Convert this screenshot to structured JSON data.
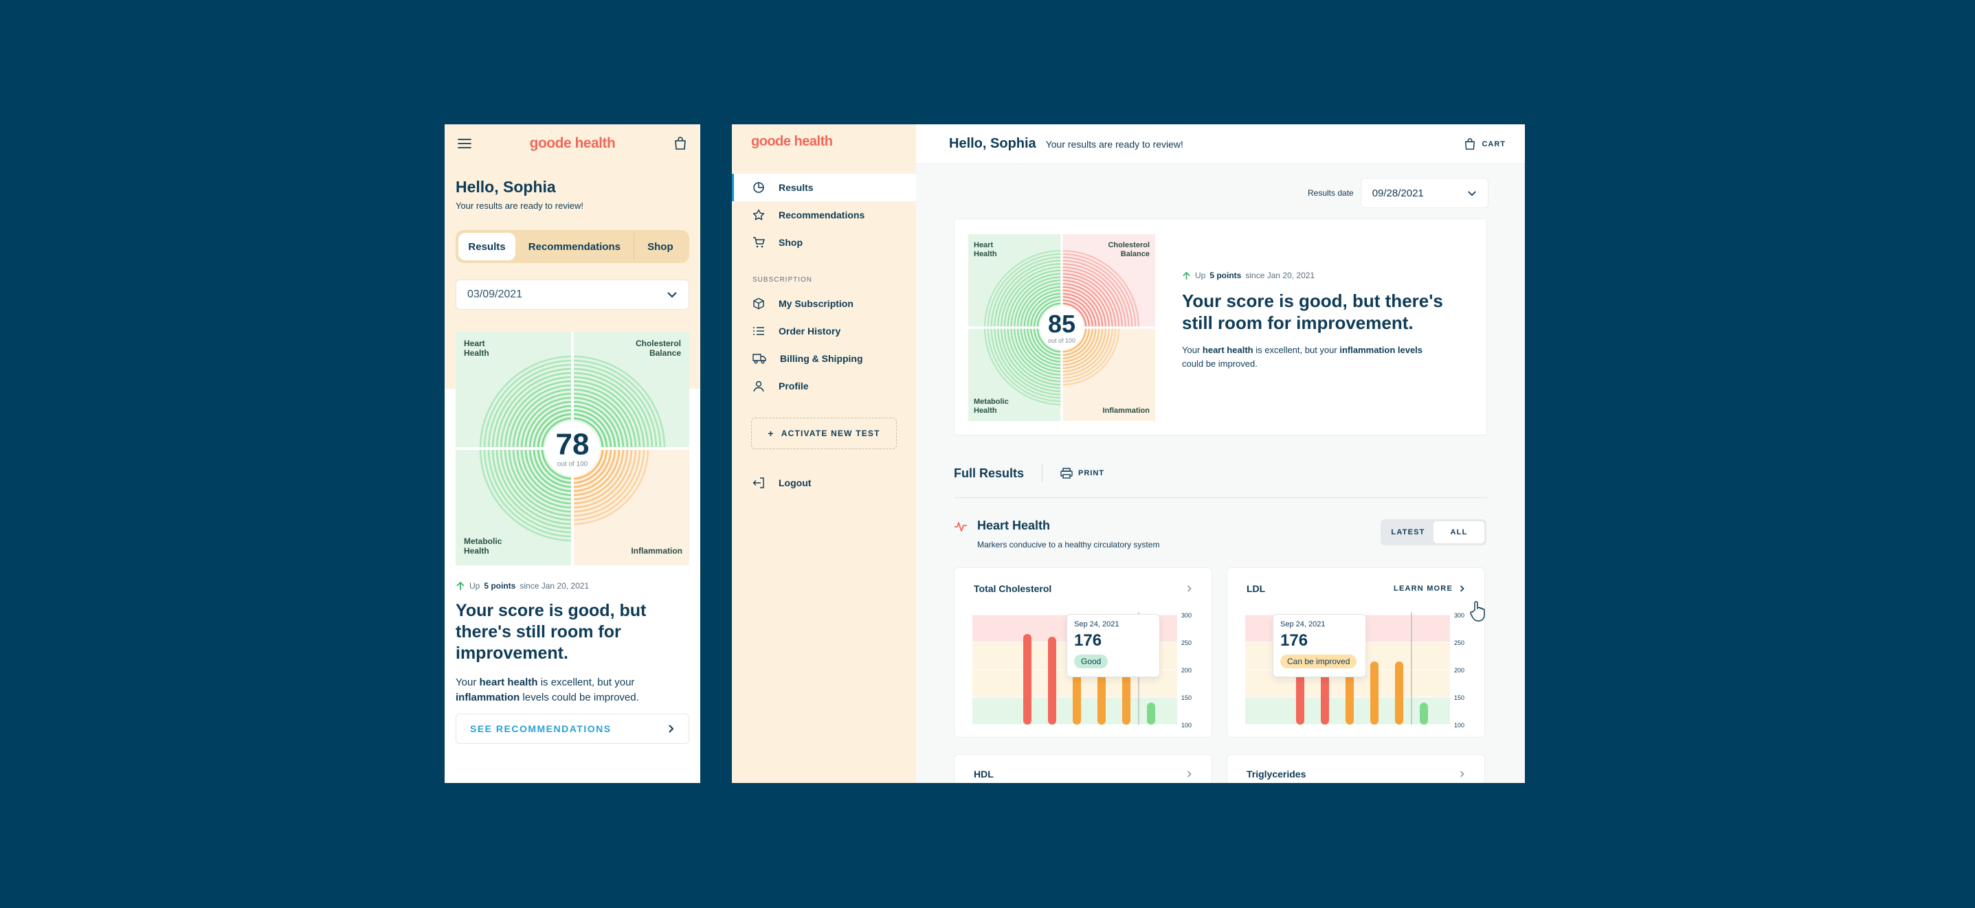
{
  "brand": {
    "logo": "goode health"
  },
  "greeting": {
    "hello": "Hello, Sophia",
    "ready": "Your results are ready to review!"
  },
  "mobile": {
    "tabs": [
      "Results",
      "Recommendations",
      "Shop"
    ],
    "date": "03/09/2021",
    "score": {
      "value": "78",
      "out_of": "out of 100"
    },
    "up_prefix": "Up",
    "up_points": "5 points",
    "up_suffix": "since Jan 20, 2021",
    "headline": "Your score is good, but there's still room for improvement.",
    "desc_1": "Your",
    "desc_b1": "heart health",
    "desc_2": "is excellent, but your",
    "desc_b2": "inflammation",
    "desc_3": "levels could be improved.",
    "cta": "SEE RECOMMENDATIONS"
  },
  "quadrants": {
    "heart": [
      "Heart",
      "Health"
    ],
    "cholesterol": [
      "Cholesterol",
      "Balance"
    ],
    "metabolic": [
      "Metabolic",
      "Health"
    ],
    "inflammation": "Inflammation"
  },
  "sidebar": {
    "items": [
      {
        "label": "Results",
        "icon": "pie-chart-icon",
        "active": true
      },
      {
        "label": "Recommendations",
        "icon": "star-icon"
      },
      {
        "label": "Shop",
        "icon": "cart-icon"
      }
    ],
    "section_label": "SUBSCRIPTION",
    "sub_items": [
      {
        "label": "My Subscription",
        "icon": "box-icon"
      },
      {
        "label": "Order History",
        "icon": "list-icon"
      },
      {
        "label": "Billing & Shipping",
        "icon": "truck-icon"
      },
      {
        "label": "Profile",
        "icon": "user-icon"
      }
    ],
    "activate": "ACTIVATE NEW TEST",
    "logout": "Logout"
  },
  "desktop": {
    "cart": "CART",
    "results_date_label": "Results date",
    "results_date": "09/28/2021",
    "score": {
      "value": "85",
      "out_of": "out of 100"
    },
    "up_prefix": "Up",
    "up_points": "5 points",
    "up_suffix": "since Jan 20, 2021",
    "headline": "Your score is good, but there's still room for improvement.",
    "desc_1": "Your",
    "desc_b1": "heart health",
    "desc_2": "is excellent, but your",
    "desc_b2": "inflammation levels",
    "desc_3": "could be improved.",
    "full_results": "Full Results",
    "print": "PRINT",
    "section_title": "Heart Health",
    "section_sub": "Markers conducive to a healthy circulatory system",
    "toggle": [
      "LATEST",
      "ALL"
    ],
    "learn_more": "LEARN MORE",
    "cards": [
      {
        "title": "Total Cholesterol",
        "tip_date": "Sep 24, 2021",
        "tip_value": "176",
        "tip_badge": "Good"
      },
      {
        "title": "LDL",
        "tip_date": "Sep 24, 2021",
        "tip_value": "176",
        "tip_badge": "Can be improved"
      },
      {
        "title": "HDL"
      },
      {
        "title": "Triglycerides"
      }
    ]
  },
  "chart_data": [
    {
      "type": "bar",
      "title": "Total Cholesterol",
      "ylim": [
        100,
        300
      ],
      "y_ticks": [
        "300",
        "250",
        "200",
        "150",
        "100"
      ],
      "values": [
        265,
        260,
        240,
        225,
        215,
        140
      ],
      "colors": [
        "#f2695b",
        "#f2695b",
        "#f5a23a",
        "#f5a23a",
        "#f5a23a",
        "#7ed98d"
      ]
    },
    {
      "type": "bar",
      "title": "LDL",
      "ylim": [
        100,
        300
      ],
      "y_ticks": [
        "300",
        "250",
        "200",
        "150",
        "100"
      ],
      "values": [
        240,
        235,
        220,
        215,
        215,
        140
      ],
      "colors": [
        "#f2695b",
        "#f2695b",
        "#f5a23a",
        "#f5a23a",
        "#f5a23a",
        "#7ed98d"
      ]
    }
  ],
  "colors": {
    "background": "#003f5f",
    "accent": "#f0685a",
    "link": "#2aa0d6",
    "good": "#7ed98d",
    "warn": "#f5a23a",
    "bad": "#f2695b"
  }
}
